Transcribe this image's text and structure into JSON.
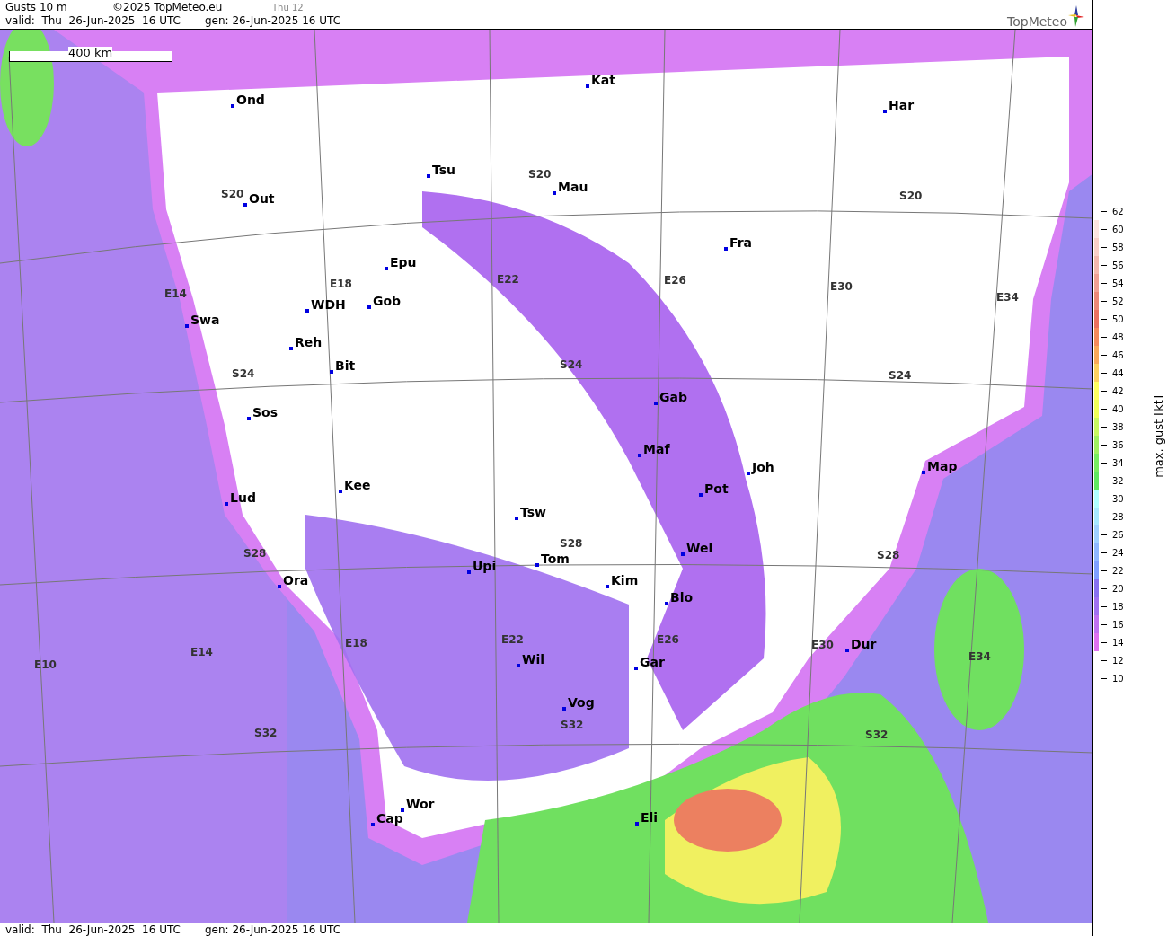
{
  "header": {
    "title": "Gusts 10 m",
    "copyright": "©2025 TopMeteo.eu",
    "time_tag": "Thu 12",
    "valid": "valid:  Thu  26-Jun-2025  16 UTC",
    "gen": "gen: 26-Jun-2025 16 UTC",
    "logo": "TopMeteo"
  },
  "map": {
    "scale_bar": "400 km",
    "grid_labels": [
      "S20",
      "S20",
      "S20",
      "E14",
      "E18",
      "E22",
      "E26",
      "E30",
      "E34",
      "S24",
      "S24",
      "S24",
      "S28",
      "S28",
      "S28",
      "E10",
      "E14",
      "E18",
      "E22",
      "E26",
      "E30",
      "E34",
      "S32",
      "S32",
      "S32"
    ],
    "stations": [
      {
        "name": "Ond"
      },
      {
        "name": "Kat"
      },
      {
        "name": "Har"
      },
      {
        "name": "Tsu"
      },
      {
        "name": "Mau"
      },
      {
        "name": "Out"
      },
      {
        "name": "Fra"
      },
      {
        "name": "Epu"
      },
      {
        "name": "WDH"
      },
      {
        "name": "Gob"
      },
      {
        "name": "Swa"
      },
      {
        "name": "Reh"
      },
      {
        "name": "Bit"
      },
      {
        "name": "Sos"
      },
      {
        "name": "Gab"
      },
      {
        "name": "Maf"
      },
      {
        "name": "Joh"
      },
      {
        "name": "Map"
      },
      {
        "name": "Kee"
      },
      {
        "name": "Lud"
      },
      {
        "name": "Pot"
      },
      {
        "name": "Tsw"
      },
      {
        "name": "Wel"
      },
      {
        "name": "Tom"
      },
      {
        "name": "Upi"
      },
      {
        "name": "Ora"
      },
      {
        "name": "Kim"
      },
      {
        "name": "Blo"
      },
      {
        "name": "Dur"
      },
      {
        "name": "Wil"
      },
      {
        "name": "Gar"
      },
      {
        "name": "Vog"
      },
      {
        "name": "Wor"
      },
      {
        "name": "Cap"
      },
      {
        "name": "Eli"
      }
    ]
  },
  "legend": {
    "title": "max. gust [kt]",
    "ticks": [
      "62",
      "60",
      "58",
      "56",
      "54",
      "52",
      "50",
      "48",
      "46",
      "44",
      "42",
      "40",
      "38",
      "36",
      "34",
      "32",
      "30",
      "28",
      "26",
      "24",
      "22",
      "20",
      "18",
      "16",
      "14",
      "12",
      "10"
    ],
    "bands": [
      {
        "color": "#fce4e0"
      },
      {
        "color": "#f9cfc8"
      },
      {
        "color": "#f4b8ae"
      },
      {
        "color": "#f0a094"
      },
      {
        "color": "#ec8878"
      },
      {
        "color": "#ea7060"
      },
      {
        "color": "#f58a5c"
      },
      {
        "color": "#f9a85a"
      },
      {
        "color": "#fdd060"
      },
      {
        "color": "#ffff60"
      },
      {
        "color": "#f0ff58"
      },
      {
        "color": "#c8f860"
      },
      {
        "color": "#a0f060"
      },
      {
        "color": "#78ec60"
      },
      {
        "color": "#60e860"
      },
      {
        "color": "#b0ffff"
      },
      {
        "color": "#a8e8ff"
      },
      {
        "color": "#a0d0ff"
      },
      {
        "color": "#90b8ff"
      },
      {
        "color": "#80a0ff"
      },
      {
        "color": "#8870f0"
      },
      {
        "color": "#a070f0"
      },
      {
        "color": "#c070f0"
      },
      {
        "color": "#e070f0"
      }
    ]
  },
  "footer": {
    "valid": "valid:  Thu  26-Jun-2025  16 UTC",
    "gen": "gen: 26-Jun-2025 16 UTC"
  }
}
